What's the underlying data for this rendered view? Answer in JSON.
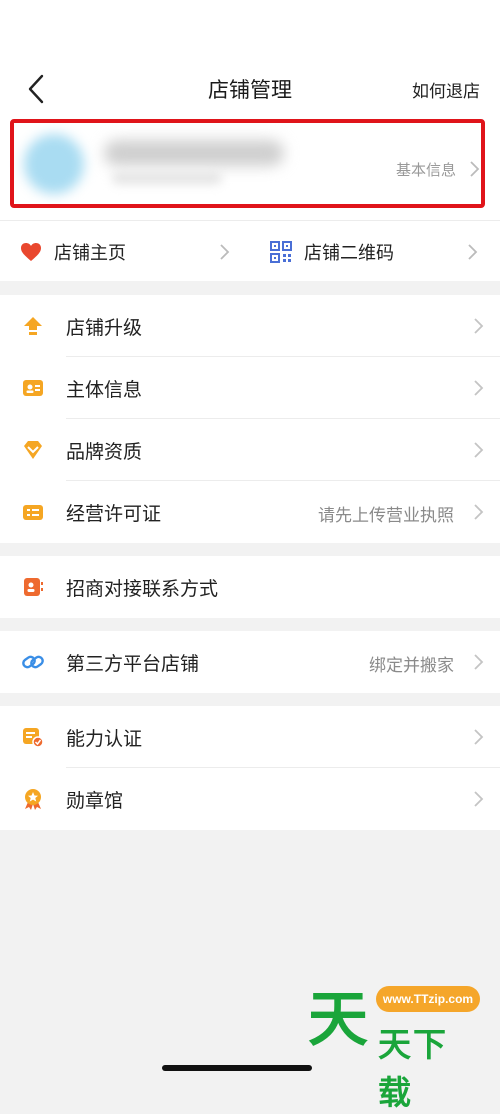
{
  "header": {
    "title": "店铺管理",
    "how_to_exit": "如何退店"
  },
  "store_card": {
    "basic_info_label": "基本信息"
  },
  "shop_links": {
    "homepage": "店铺主页",
    "qrcode": "店铺二维码"
  },
  "menu_groups": [
    {
      "items": [
        {
          "label": "店铺升级",
          "value": "",
          "icon": "upgrade-arrow-icon"
        },
        {
          "label": "主体信息",
          "value": "",
          "icon": "id-card-icon"
        },
        {
          "label": "品牌资质",
          "value": "",
          "icon": "diamond-icon"
        },
        {
          "label": "经营许可证",
          "value": "请先上传营业执照",
          "icon": "license-icon"
        }
      ]
    },
    {
      "items": [
        {
          "label": "招商对接联系方式",
          "value": "",
          "icon": "contact-card-icon"
        }
      ]
    },
    {
      "items": [
        {
          "label": "第三方平台店铺",
          "value": "绑定并搬家",
          "icon": "link-icon"
        }
      ]
    },
    {
      "items": [
        {
          "label": "能力认证",
          "value": "",
          "icon": "certificate-icon"
        },
        {
          "label": "勋章馆",
          "value": "",
          "icon": "medal-icon"
        }
      ]
    }
  ],
  "watermark": {
    "url": "www.TTzip.com",
    "big_char": "天",
    "text": "天下载"
  },
  "colors": {
    "accent_orange": "#f5a623",
    "highlight_red": "#e0141a",
    "heart_red": "#e9472e",
    "qr_blue": "#4a6fd6"
  }
}
